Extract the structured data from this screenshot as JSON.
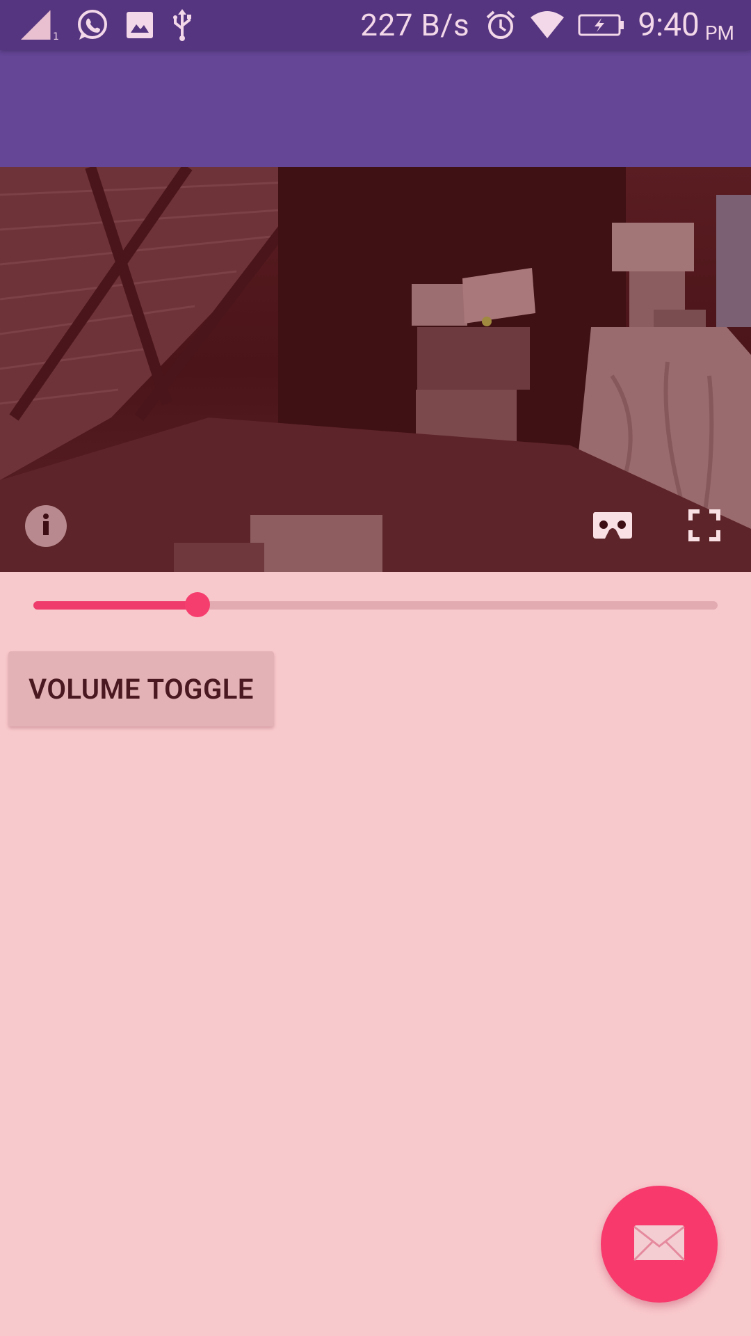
{
  "status_bar": {
    "network_speed": "227 B/s",
    "time": "9:40",
    "ampm": "PM",
    "icons": [
      "signal-icon",
      "whatsapp-icon",
      "gallery-icon",
      "usb-icon",
      "alarm-icon",
      "wifi-icon",
      "battery-charging-icon"
    ]
  },
  "app_bar": {
    "title": ""
  },
  "video": {
    "controls": [
      "info-icon",
      "cardboard-vr-icon",
      "fullscreen-icon"
    ]
  },
  "slider": {
    "progress": 0.24
  },
  "buttons": {
    "volume_toggle": "VOLUME TOGGLE"
  },
  "fab": {
    "icon": "mail-icon"
  },
  "colors": {
    "status_bar": "#563580",
    "app_bar": "#644596",
    "background": "#f8c9cc",
    "accent": "#f7396c",
    "button_bg": "#e2b2b6"
  }
}
